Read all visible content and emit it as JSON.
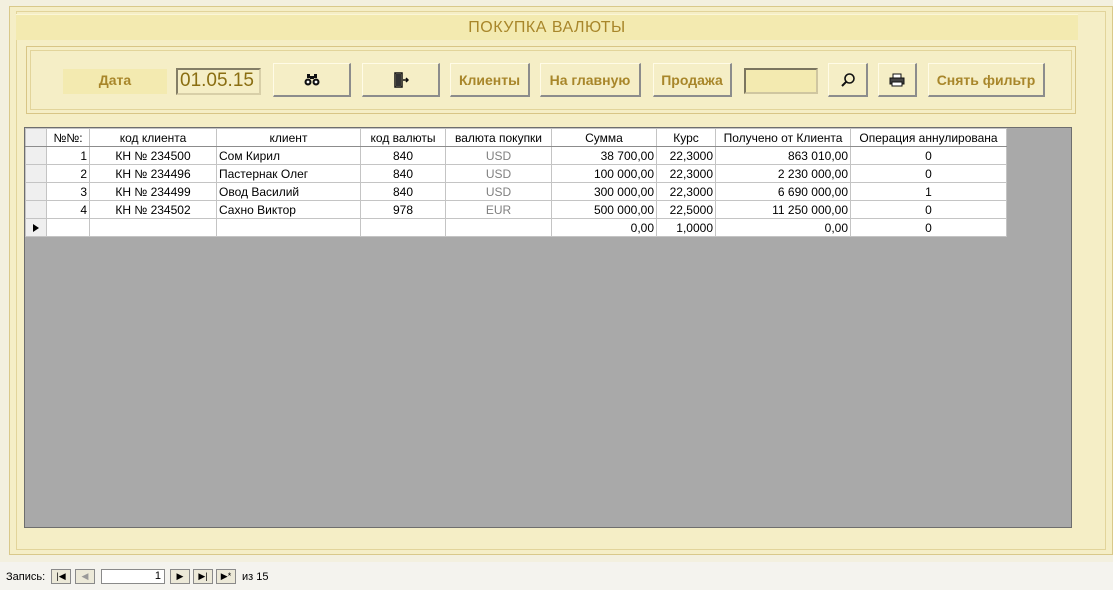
{
  "title": "ПОКУПКА ВАЛЮТЫ",
  "toolbar": {
    "date_label": "Дата",
    "date_value": "01.05.15",
    "find_icon": "binoculars-icon",
    "exit_icon": "exit-door-icon",
    "clients_label": "Клиенты",
    "home_label": "На главную",
    "sale_label": "Продажа",
    "filter_value": "",
    "search_icon": "magnifier-icon",
    "print_icon": "printer-icon",
    "clear_filter_label": "Снять фильтр"
  },
  "grid": {
    "columns": [
      "№№:",
      "код клиента",
      "клиент",
      "код валюты",
      "валюта покупки",
      "Сумма",
      "Курс",
      "Получено от Клиента",
      "Операция аннулирована"
    ],
    "rows": [
      {
        "num": "1",
        "client_code": "КН № 234500",
        "client": "Сом Кирил",
        "currency_code": "840",
        "currency": "USD",
        "sum": "38 700,00",
        "rate": "22,3000",
        "received": "863 010,00",
        "cancelled": "0"
      },
      {
        "num": "2",
        "client_code": "КН № 234496",
        "client": "Пастернак Олег",
        "currency_code": "840",
        "currency": "USD",
        "sum": "100 000,00",
        "rate": "22,3000",
        "received": "2 230 000,00",
        "cancelled": "0"
      },
      {
        "num": "3",
        "client_code": "КН № 234499",
        "client": "Овод Василий",
        "currency_code": "840",
        "currency": "USD",
        "sum": "300 000,00",
        "rate": "22,3000",
        "received": "6 690 000,00",
        "cancelled": "1"
      },
      {
        "num": "4",
        "client_code": "КН № 234502",
        "client": "Сахно Виктор",
        "currency_code": "978",
        "currency": "EUR",
        "sum": "500 000,00",
        "rate": "22,5000",
        "received": "11 250 000,00",
        "cancelled": "0"
      }
    ],
    "new_row": {
      "sum": "0,00",
      "rate": "1,0000",
      "received": "0,00",
      "cancelled": "0"
    }
  },
  "status": {
    "record_label": "Запись:",
    "current_record": "1",
    "of_label": "из",
    "total_records": "15"
  }
}
